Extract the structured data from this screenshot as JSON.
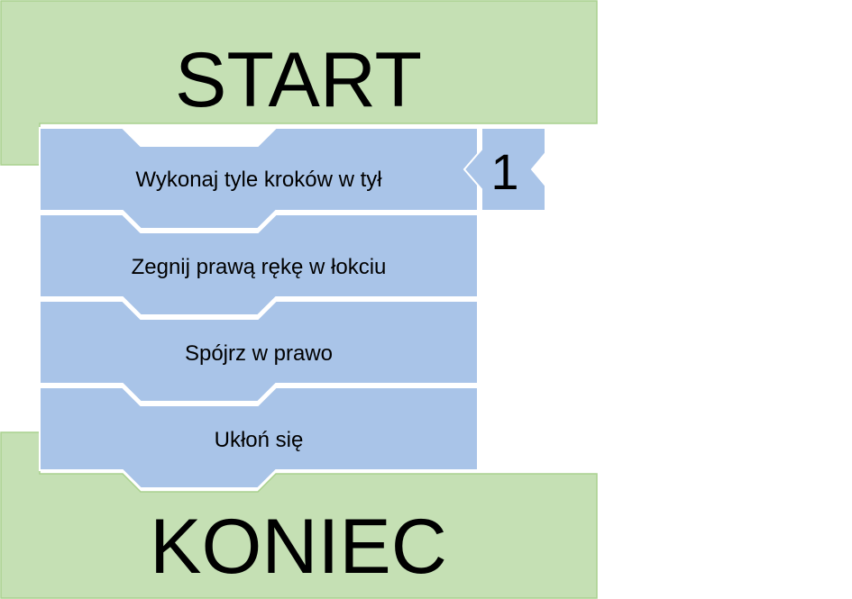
{
  "start_block": {
    "label": "START"
  },
  "end_block": {
    "label": "KONIEC"
  },
  "commands": [
    {
      "label": "Wykonaj tyle kroków w tył",
      "parameter": "1"
    },
    {
      "label": "Zegnij prawą rękę w łokciu"
    },
    {
      "label": "Spójrz w prawo"
    },
    {
      "label": "Ukłoń się"
    }
  ],
  "colors": {
    "start_end_fill": "#c5e0b4",
    "command_fill": "#a9c4e8"
  }
}
